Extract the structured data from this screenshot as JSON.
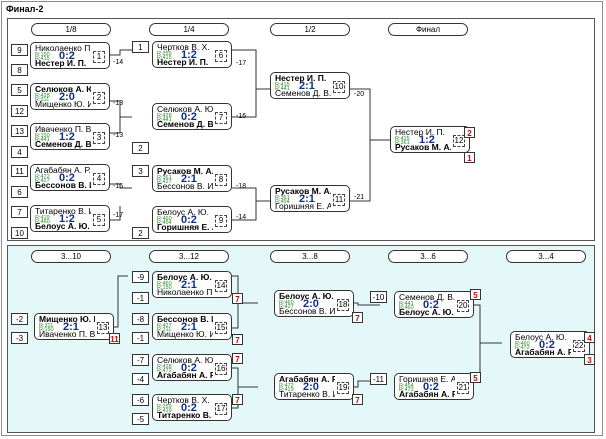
{
  "window": {
    "title": "Финал-2"
  },
  "main": {
    "rounds": [
      "1/8",
      "1/4",
      "1/2",
      "Финал"
    ],
    "seeds_r1": [
      "9",
      "8",
      "5",
      "12",
      "13",
      "4",
      "11",
      "6",
      "7",
      "10"
    ],
    "seeds_r2": [
      "1",
      "2",
      "3",
      "2"
    ],
    "matches": [
      {
        "p1": "Николаенко П.",
        "p2": "Нестер И. П.",
        "r1": "R:150",
        "r2": "R:415",
        "score": "0:2",
        "num": "1",
        "win": 2
      },
      {
        "p1": "Селюков А. Ю.",
        "p2": "Мищенко Ю. И.",
        "r1": "R:428",
        "r2": "R:311",
        "score": "2:0",
        "num": "2",
        "win": 1
      },
      {
        "p1": "Иваченко П. В.",
        "p2": "Семенов Д. В.",
        "r1": "R:150",
        "r2": "R:441",
        "score": "1:2",
        "num": "3",
        "win": 2
      },
      {
        "p1": "Агабабян А. Р.",
        "p2": "Бессонов В. И.",
        "r1": "R:472",
        "r2": "R:427",
        "score": "0:2",
        "num": "4",
        "win": 2
      },
      {
        "p1": "Титаренко В. И.",
        "p2": "Белоус А. Ю.",
        "r1": "R:419",
        "r2": "R:460",
        "score": "1:2",
        "num": "5",
        "win": 2
      },
      {
        "p1": "Чертков В. Х.",
        "p2": "Нестер И. П.",
        "r1": "R:259",
        "r2": "R:415",
        "score": "1:2",
        "num": "6",
        "win": 2
      },
      {
        "p1": "Селюков А. Ю.",
        "p2": "Семенов Д. В.",
        "r1": "R:428",
        "r2": "R:441",
        "score": "0:2",
        "num": "7",
        "win": 2
      },
      {
        "p1": "Русаков М. А.",
        "p2": "Бессонов В. И.",
        "r1": "R:361",
        "r2": "R:427",
        "score": "2:1",
        "num": "8",
        "win": 1
      },
      {
        "p1": "Белоус А. Ю.",
        "p2": "Горишняя Е. А.",
        "r1": "R:460",
        "r2": "R:454",
        "score": "0:2",
        "num": "9",
        "win": 2
      },
      {
        "p1": "Нестер И. П.",
        "p2": "Семенов Д. В.",
        "r1": "R:415",
        "r2": "R:441",
        "score": "2:1",
        "num": "10",
        "win": 1
      },
      {
        "p1": "Русаков М. А.",
        "p2": "Горишняя Е. А.",
        "r1": "R:361",
        "r2": "R:454",
        "score": "2:1",
        "num": "11",
        "win": 1
      },
      {
        "p1": "Нестер И. П.",
        "p2": "Русаков М. А.",
        "r1": "R:415",
        "r2": "R:361",
        "score": "1:2",
        "num": "12",
        "win": 2
      }
    ],
    "links": [
      "-14",
      "-13",
      "-13",
      "-15",
      "-17",
      "-17",
      "-16",
      "-18",
      "-14",
      "-20",
      "-21"
    ],
    "places": [
      "2",
      "1"
    ]
  },
  "cons": {
    "rounds": [
      "3...10",
      "3...12",
      "3...8",
      "3...6",
      "3...4"
    ],
    "seeds_left": [
      "-2",
      "-3"
    ],
    "seeds_r2": [
      "-9",
      "-1",
      "-8",
      "-1",
      "-7",
      "-4",
      "-6",
      "-5"
    ],
    "seeds_r4": [
      "-10",
      "-11"
    ],
    "matches": [
      {
        "p1": "Мищенко Ю. И.",
        "p2": "Иваченко П. В.",
        "r1": "R:311",
        "r2": "R:150",
        "score": "2:1",
        "num": "13",
        "win": 1
      },
      {
        "p1": "Белоус А. Ю.",
        "p2": "Николаенко П.",
        "r1": "R:460",
        "r2": "R:150",
        "score": "2:1",
        "num": "14",
        "win": 1
      },
      {
        "p1": "Бессонов В. И.",
        "p2": "Мищенко Ю. И.",
        "r1": "R:427",
        "r2": "R:311",
        "score": "2:1",
        "num": "15",
        "win": 1
      },
      {
        "p1": "Селюков А. Ю.",
        "p2": "Агабабян А. Р.",
        "r1": "R:428",
        "r2": "R:472",
        "score": "0:2",
        "num": "16",
        "win": 2
      },
      {
        "p1": "Чертков В. Х.",
        "p2": "Титаренко В. И.",
        "r1": "R:259",
        "r2": "R:419",
        "score": "0:2",
        "num": "17",
        "win": 2
      },
      {
        "p1": "Белоус А. Ю.",
        "p2": "Бессонов В. И.",
        "r1": "R:460",
        "r2": "R:427",
        "score": "2:0",
        "num": "18",
        "win": 1
      },
      {
        "p1": "Агабабян А. Р.",
        "p2": "Титаренко В. И.",
        "r1": "R:472",
        "r2": "R:419",
        "score": "2:0",
        "num": "19",
        "win": 1
      },
      {
        "p1": "Семенов Д. В.",
        "p2": "Белоус А. Ю.",
        "r1": "R:441",
        "r2": "R:460",
        "score": "0:2",
        "num": "20",
        "win": 2
      },
      {
        "p1": "Горишняя Е. А.",
        "p2": "Агабабян А. Р.",
        "r1": "R:454",
        "r2": "R:472",
        "score": "0:2",
        "num": "21",
        "win": 2
      },
      {
        "p1": "Белоус А. Ю.",
        "p2": "Агабабян А. Р.",
        "r1": "R:460",
        "r2": "R:472",
        "score": "0:2",
        "num": "22",
        "win": 2
      }
    ],
    "places": [
      "11",
      "7",
      "7",
      "7",
      "7",
      "7",
      "7",
      "7",
      "7",
      "5",
      "5",
      "4",
      "3"
    ]
  }
}
